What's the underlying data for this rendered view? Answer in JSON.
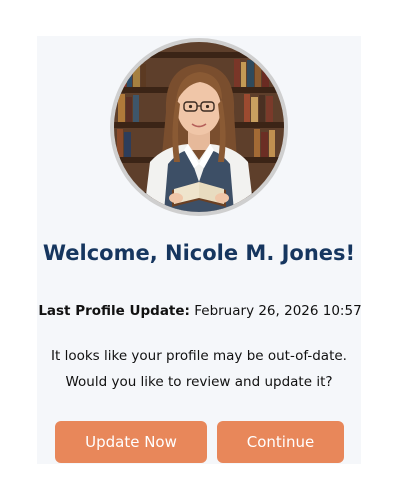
{
  "profile": {
    "welcome_text": "Welcome, Nicole M. Jones!",
    "last_update_label": "Last Profile Update:",
    "last_update_value": "February 26, 2026 10:57",
    "message_line1": "It looks like your profile may be out-of-date.",
    "message_line2": "Would you like to review and update it?"
  },
  "actions": {
    "update_label": "Update Now",
    "continue_label": "Continue"
  },
  "colors": {
    "accent": "#e8875a",
    "title": "#16365f",
    "card_bg": "#f5f7fa"
  },
  "icons": {
    "avatar": "user-photo"
  }
}
